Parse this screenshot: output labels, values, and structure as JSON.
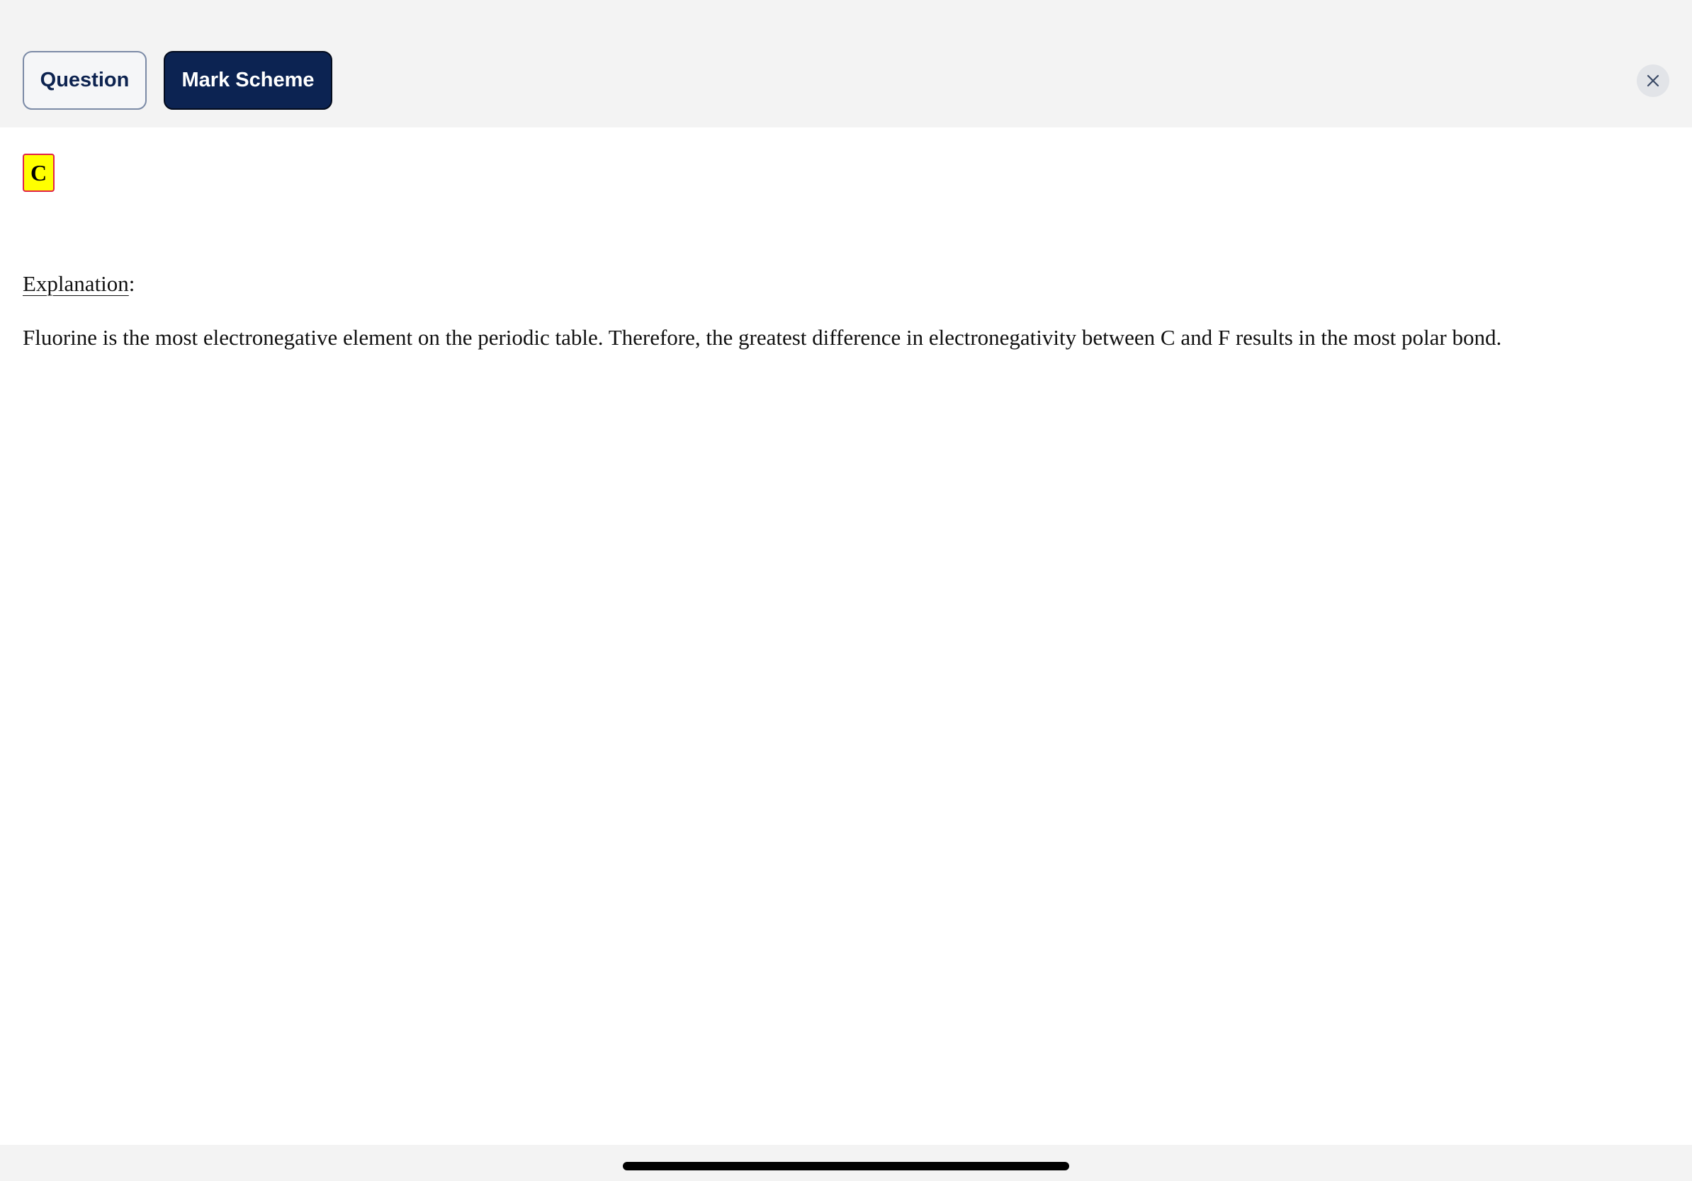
{
  "header": {
    "tabs": [
      {
        "label": "Question",
        "active": false
      },
      {
        "label": "Mark Scheme",
        "active": true
      }
    ],
    "close_icon": "close-icon"
  },
  "content": {
    "answer": "C",
    "explanation_label": "Explanation",
    "explanation_colon": ":",
    "explanation_text": "Fluorine is the most electronegative element on the periodic table. Therefore, the greatest difference in electronegativity between C and F results in the most polar bond."
  },
  "colors": {
    "accent": "#0c2352",
    "answer_highlight": "#ffff00",
    "answer_border": "#e0204a"
  }
}
